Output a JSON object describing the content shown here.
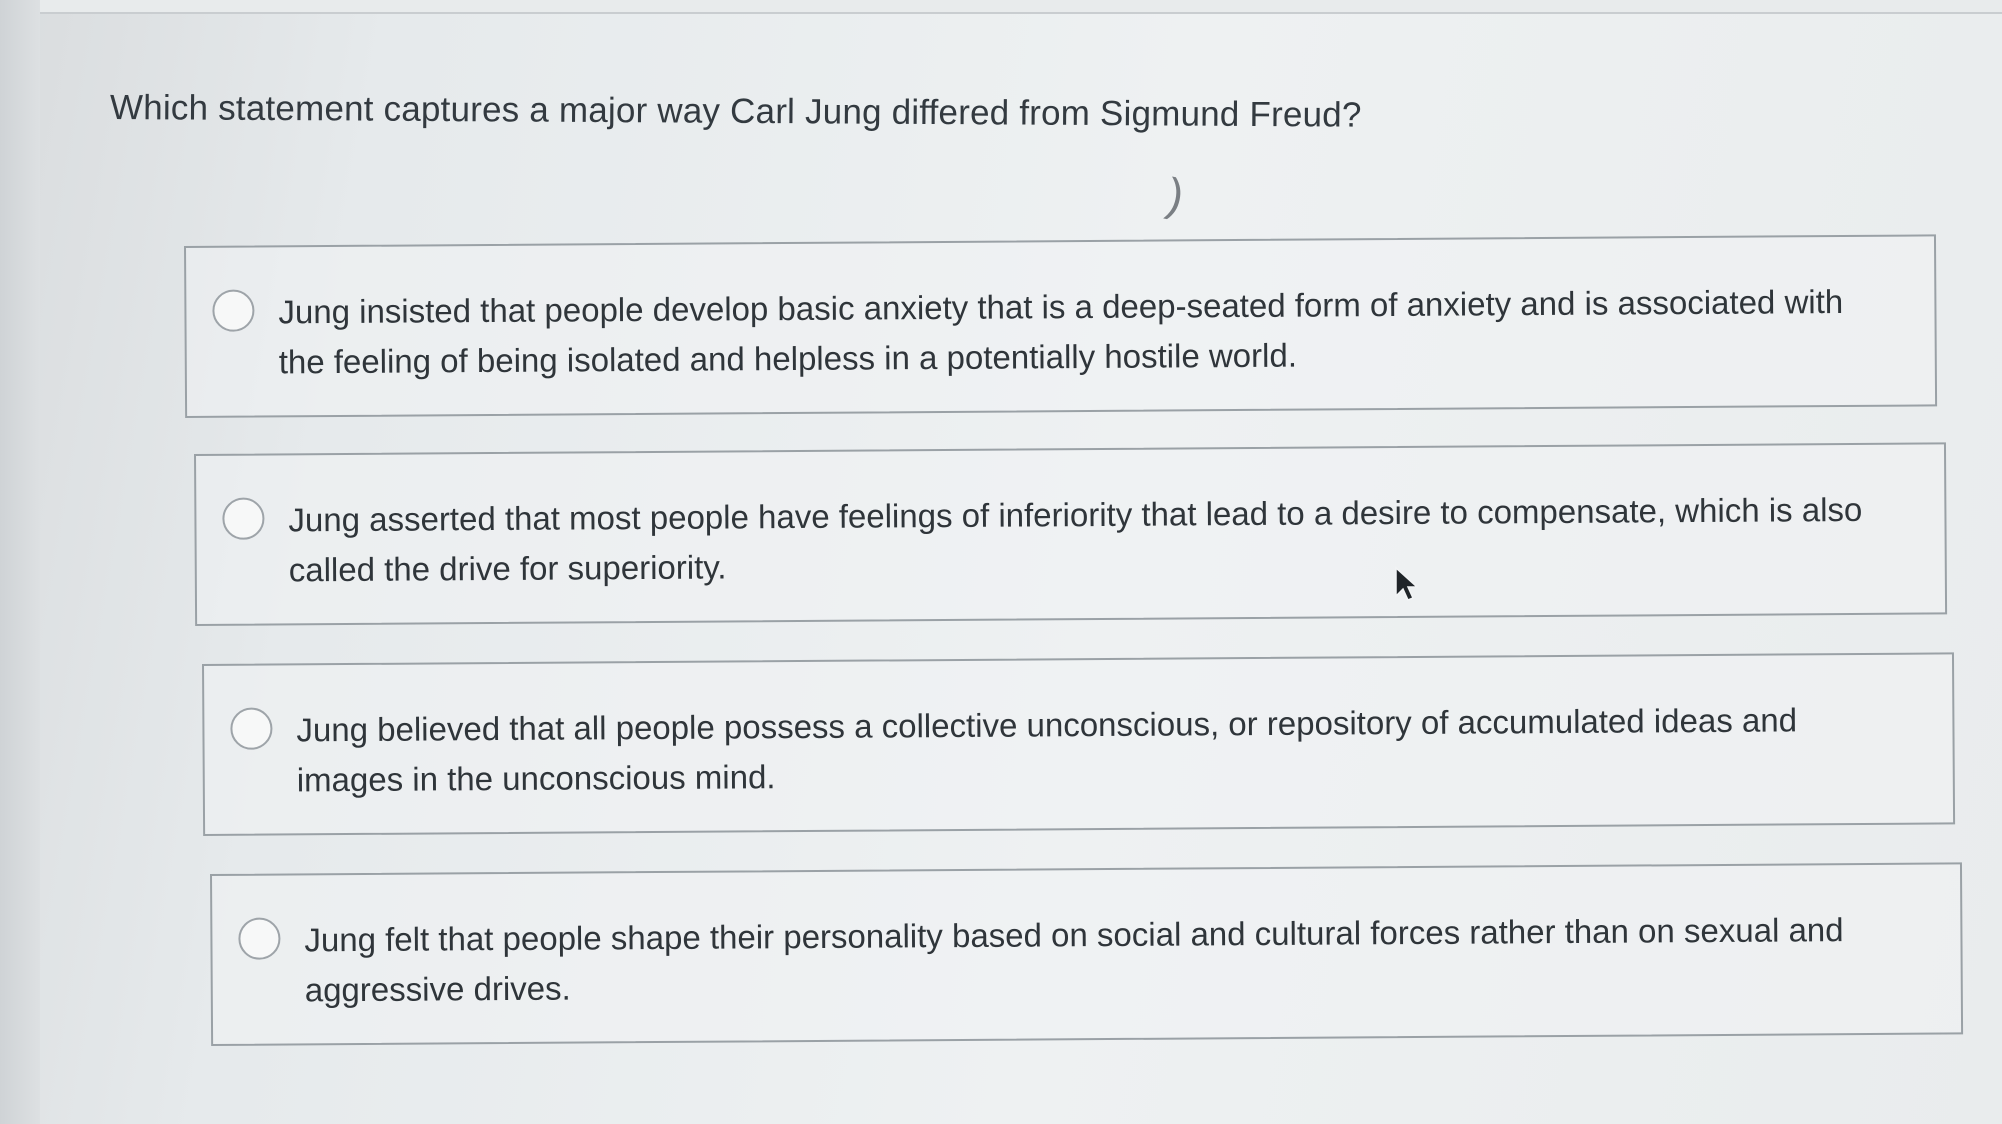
{
  "question": "Which statement captures a major way Carl Jung differed from Sigmund Freud?",
  "stray_mark": ")",
  "options": [
    {
      "text": "Jung insisted that people develop basic anxiety that is a deep-seated form of anxiety and is associated with the feeling of being isolated and helpless in a potentially hostile world.",
      "selected": false
    },
    {
      "text": "Jung asserted that most people have feelings of inferiority that lead to a desire to compensate, which is also called the drive for superiority.",
      "selected": false
    },
    {
      "text": "Jung believed that all people possess a collective unconscious, or repository of accumulated ideas and images in the unconscious mind.",
      "selected": false
    },
    {
      "text": "Jung felt that people shape their personality based on social and cultural forces rather than on sexual and aggressive drives.",
      "selected": false
    }
  ],
  "icons": {
    "radio": "radio-unselected-icon",
    "cursor": "mouse-pointer-icon"
  },
  "colors": {
    "text": "#2f353a",
    "border": "#9aa1a6",
    "background": "#eef1f2"
  }
}
